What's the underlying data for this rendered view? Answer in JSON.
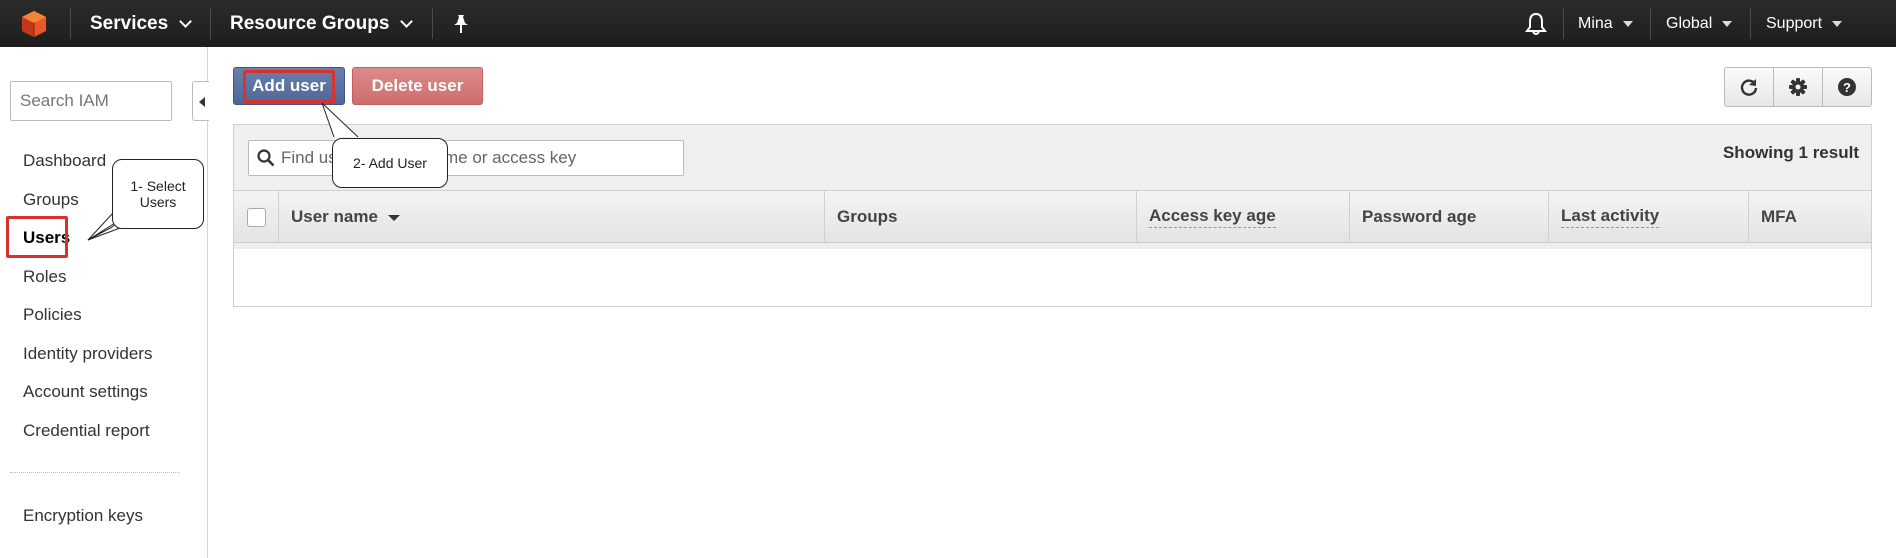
{
  "topnav": {
    "services": "Services",
    "resource_groups": "Resource Groups",
    "user": "Mina",
    "region": "Global",
    "support": "Support"
  },
  "sidebar": {
    "search_placeholder": "Search IAM",
    "items": [
      {
        "label": "Dashboard"
      },
      {
        "label": "Groups"
      },
      {
        "label": "Users",
        "active": true
      },
      {
        "label": "Roles"
      },
      {
        "label": "Policies"
      },
      {
        "label": "Identity providers"
      },
      {
        "label": "Account settings"
      },
      {
        "label": "Credential report"
      }
    ],
    "footer_items": [
      {
        "label": "Encryption keys"
      }
    ]
  },
  "toolbar": {
    "add_user": "Add user",
    "delete_user": "Delete user",
    "icons": [
      "refresh-icon",
      "gear-icon",
      "help-icon"
    ]
  },
  "filter": {
    "placeholder": "Find users by username or access key",
    "visible_start": "Find us",
    "visible_end": "me or access key",
    "result_text": "Showing 1 result"
  },
  "table": {
    "columns": [
      "User name",
      "Groups",
      "Access key age",
      "Password age",
      "Last activity",
      "MFA"
    ]
  },
  "callouts": {
    "step1": "1- Select Users",
    "step2": "2- Add User"
  },
  "colors": {
    "nav_bg": "#232323",
    "add_button": "#5a71a3",
    "delete_button": "#d57c7c",
    "highlight": "#d9322e"
  }
}
